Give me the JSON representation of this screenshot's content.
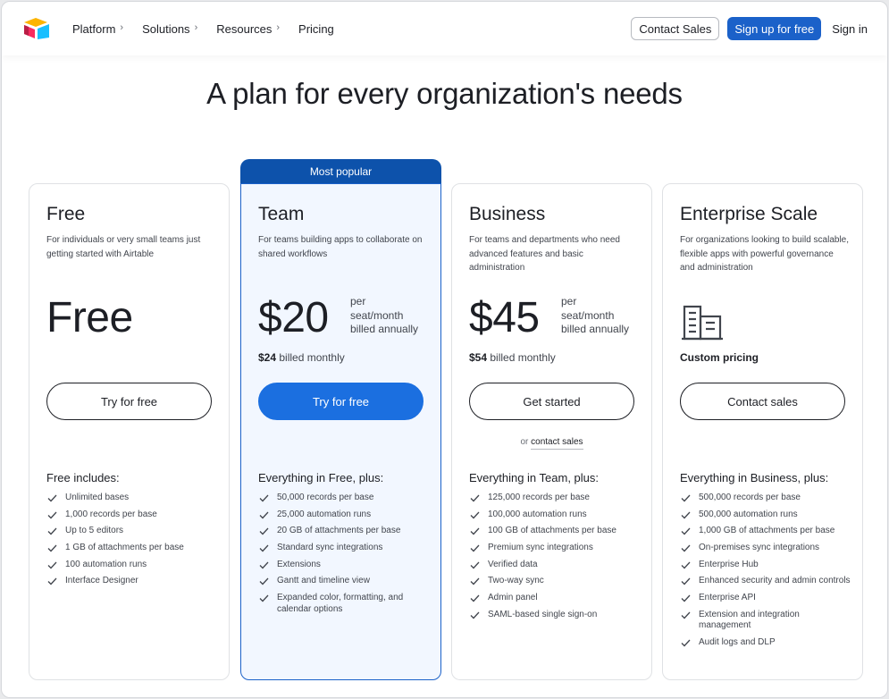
{
  "nav": {
    "links": [
      {
        "label": "Platform",
        "chevron": true
      },
      {
        "label": "Solutions",
        "chevron": true
      },
      {
        "label": "Resources",
        "chevron": true
      },
      {
        "label": "Pricing",
        "chevron": false
      }
    ],
    "contact_sales": "Contact Sales",
    "signup": "Sign up for free",
    "signin": "Sign in"
  },
  "headline": "A plan for every organization's needs",
  "colors": {
    "brand_blue": "#1b61c9",
    "cta_blue": "#1b6fe0",
    "banner_blue": "#0d52ab",
    "popular_bg": "#f2f7ff"
  },
  "plans": {
    "free": {
      "name": "Free",
      "description": "For individuals or very small teams just getting started with Airtable",
      "price": "Free",
      "cta": "Try for free",
      "features_title": "Free includes:",
      "features": [
        "Unlimited bases",
        "1,000 records per base",
        "Up to 5 editors",
        "1 GB of attachments per base",
        "100 automation runs",
        "Interface Designer"
      ]
    },
    "team": {
      "badge": "Most popular",
      "name": "Team",
      "description": "For teams building apps to collaborate on shared workflows",
      "price": "$20",
      "unit_line1": "per",
      "unit_line2": "seat/month",
      "unit_line3": "billed annually",
      "monthly_price": "$24",
      "monthly_text": " billed monthly",
      "cta": "Try for free",
      "features_title": "Everything in Free, plus:",
      "features": [
        "50,000 records per base",
        "25,000 automation runs",
        "20 GB of attachments per base",
        "Standard sync integrations",
        "Extensions",
        "Gantt and timeline view",
        "Expanded color, formatting, and calendar options"
      ]
    },
    "business": {
      "name": "Business",
      "description": "For teams and departments who need advanced features and basic administration",
      "price": "$45",
      "unit_line1": "per",
      "unit_line2": "seat/month",
      "unit_line3": "billed annually",
      "monthly_price": "$54",
      "monthly_text": " billed monthly",
      "cta": "Get started",
      "or_text": "or ",
      "or_link": "contact sales",
      "features_title": "Everything in Team, plus:",
      "features": [
        "125,000 records per base",
        "100,000 automation runs",
        "100 GB of attachments per base",
        "Premium sync integrations",
        "Verified data",
        "Two-way sync",
        "Admin panel",
        "SAML-based single sign-on"
      ]
    },
    "enterprise": {
      "name": "Enterprise Scale",
      "description": "For organizations looking to build scalable, flexible apps with powerful governance and administration",
      "icon": "building-icon",
      "custom_pricing": "Custom pricing",
      "cta": "Contact sales",
      "features_title": "Everything in Business, plus:",
      "features": [
        "500,000 records per base",
        "500,000 automation runs",
        "1,000 GB of attachments per base",
        "On-premises sync integrations",
        "Enterprise Hub",
        "Enhanced security and admin controls",
        "Enterprise API",
        "Extension and integration management",
        "Audit logs and DLP"
      ]
    }
  }
}
